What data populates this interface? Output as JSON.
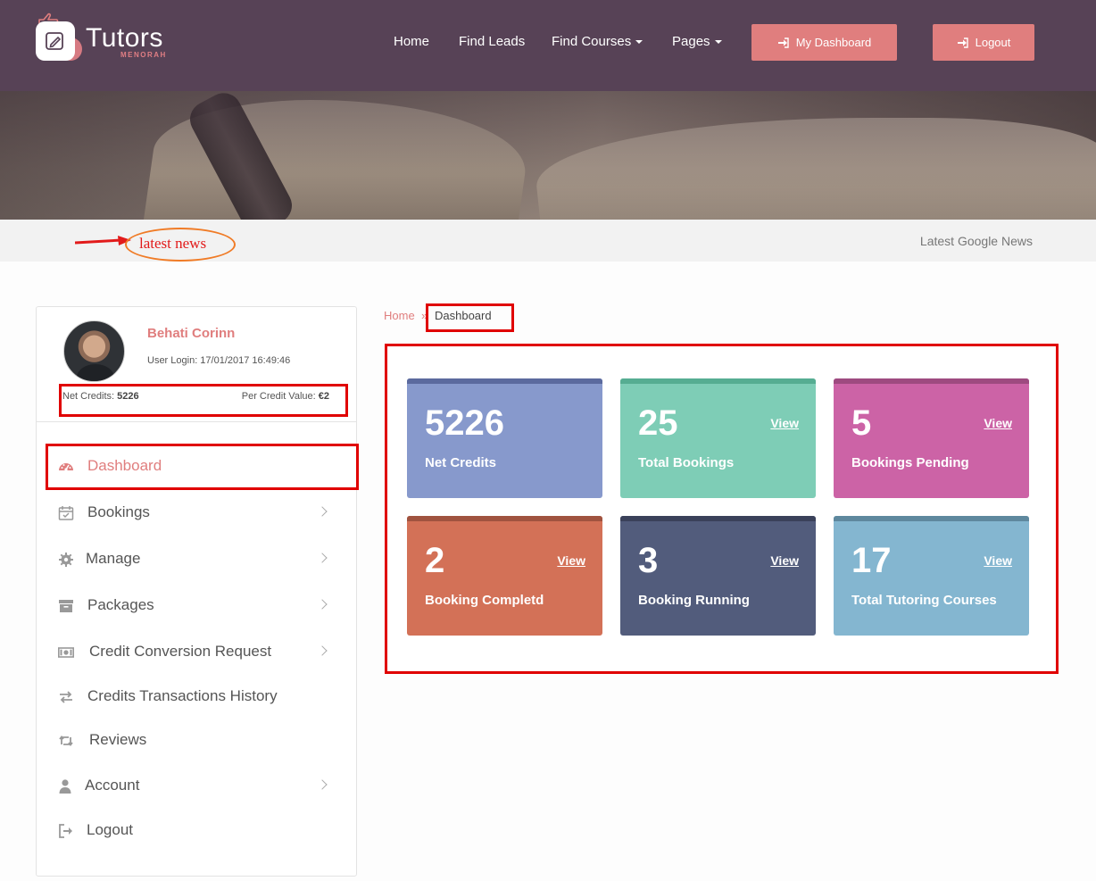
{
  "brand": {
    "title": "Tutors",
    "subtitle": "MENORAH"
  },
  "nav": {
    "items": [
      "Home",
      "Find Leads",
      "Find Courses",
      "Pages"
    ],
    "dashboard_button": "My Dashboard",
    "logout_button": "Logout"
  },
  "news": {
    "annotation": "latest news",
    "right_text": "Latest Google News"
  },
  "profile": {
    "name": "Behati Corinn",
    "login": "User Login: 17/01/2017 16:49:46",
    "net_credits_label": "Net Credits: ",
    "net_credits_value": "5226",
    "per_credit_label": "Per Credit Value: ",
    "per_credit_value": "€2"
  },
  "menu": [
    {
      "label": "Dashboard",
      "icon": "dashboard-icon",
      "chevron": false
    },
    {
      "label": "Bookings",
      "icon": "calendar-icon",
      "chevron": true
    },
    {
      "label": "Manage",
      "icon": "gear-icon",
      "chevron": true
    },
    {
      "label": "Packages",
      "icon": "archive-icon",
      "chevron": true
    },
    {
      "label": "Credit Conversion Request",
      "icon": "money-icon",
      "chevron": true
    },
    {
      "label": "Credits Transactions History",
      "icon": "exchange-icon",
      "chevron": false
    },
    {
      "label": "Reviews",
      "icon": "retweet-icon",
      "chevron": false
    },
    {
      "label": "Account",
      "icon": "user-icon",
      "chevron": true
    },
    {
      "label": "Logout",
      "icon": "sign-out-icon",
      "chevron": false
    }
  ],
  "breadcrumb": {
    "home": "Home",
    "separator": "»",
    "current": "Dashboard"
  },
  "cards": [
    {
      "value": "5226",
      "label": "Net Credits",
      "view": "",
      "color": "#8799cc",
      "accent": "#5b6a9e"
    },
    {
      "value": "25",
      "label": "Total Bookings",
      "view": "View",
      "color": "#7ecdb6",
      "accent": "#56ad92"
    },
    {
      "value": "5",
      "label": "Bookings Pending",
      "view": "View",
      "color": "#cc63a6",
      "accent": "#9e4a80"
    },
    {
      "value": "2",
      "label": "Booking Completd",
      "view": "View",
      "color": "#d37157",
      "accent": "#a0533f"
    },
    {
      "value": "3",
      "label": "Booking Running",
      "view": "View",
      "color": "#525c7c",
      "accent": "#3a415a"
    },
    {
      "value": "17",
      "label": "Total Tutoring Courses",
      "view": "View",
      "color": "#84b6d0",
      "accent": "#5e889e"
    }
  ],
  "colors": {
    "header": "#574256",
    "accent": "#e07e7e",
    "annotation": "#e00000"
  }
}
